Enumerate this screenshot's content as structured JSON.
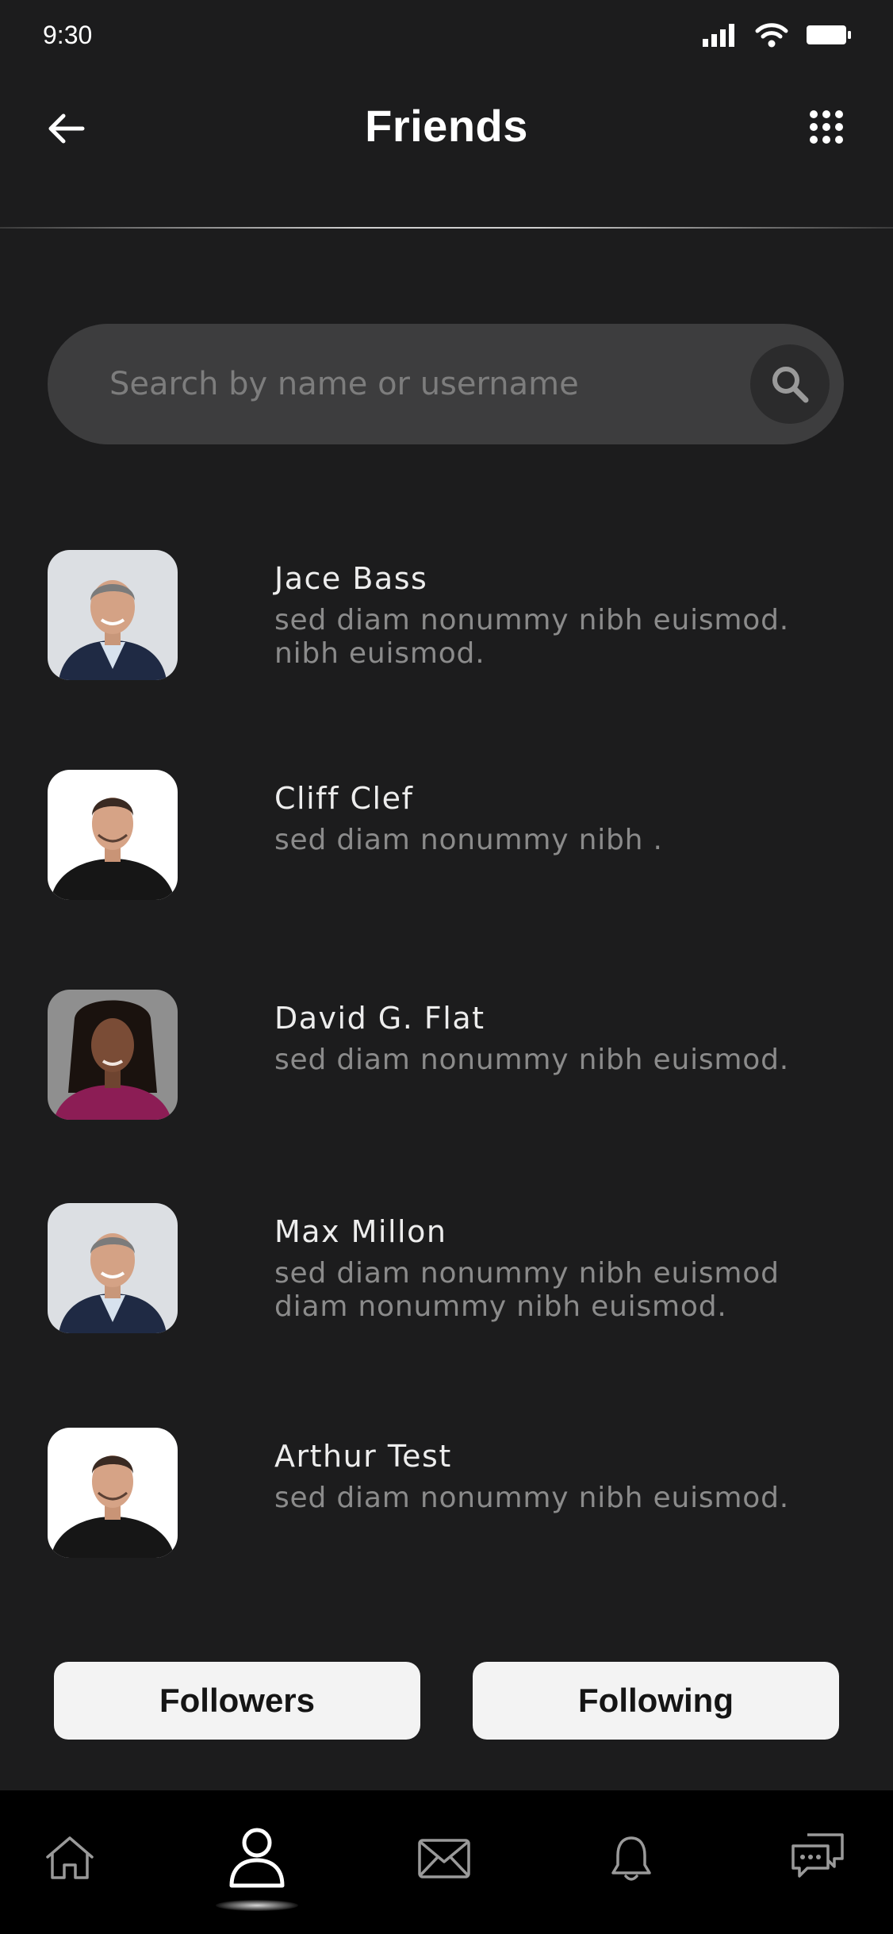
{
  "status_bar": {
    "time": "9:30",
    "icons": [
      "cellular-signal-icon",
      "wifi-icon",
      "battery-icon"
    ]
  },
  "header": {
    "title": "Friends",
    "back_icon": "arrow-left-icon",
    "menu_icon": "grid-dots-icon"
  },
  "search": {
    "placeholder": "Search by name or username",
    "value": "",
    "icon": "search-icon"
  },
  "friends": [
    {
      "name": "Jace Bass",
      "description": "sed diam nonummy nibh euismod. nibh euismod."
    },
    {
      "name": "Cliff Clef",
      "description": "sed diam nonummy nibh ."
    },
    {
      "name": "David G. Flat",
      "description": "sed diam nonummy nibh euismod."
    },
    {
      "name": "Max Millon",
      "description": "sed diam nonummy nibh euismod diam nonummy nibh euismod."
    },
    {
      "name": "Arthur Test",
      "description": "sed diam nonummy nibh euismod."
    }
  ],
  "actions": {
    "followers_label": "Followers",
    "following_label": "Following"
  },
  "bottom_nav": {
    "items": [
      "home-icon",
      "profile-icon",
      "mail-icon",
      "bell-icon",
      "chat-icon"
    ],
    "active": "profile-icon"
  },
  "colors": {
    "background": "#1c1c1d",
    "search_field": "#3d3d3e",
    "button_bg": "#f3f3f3",
    "nav_bg": "#000000",
    "secondary_text": "#8b8b8b"
  }
}
